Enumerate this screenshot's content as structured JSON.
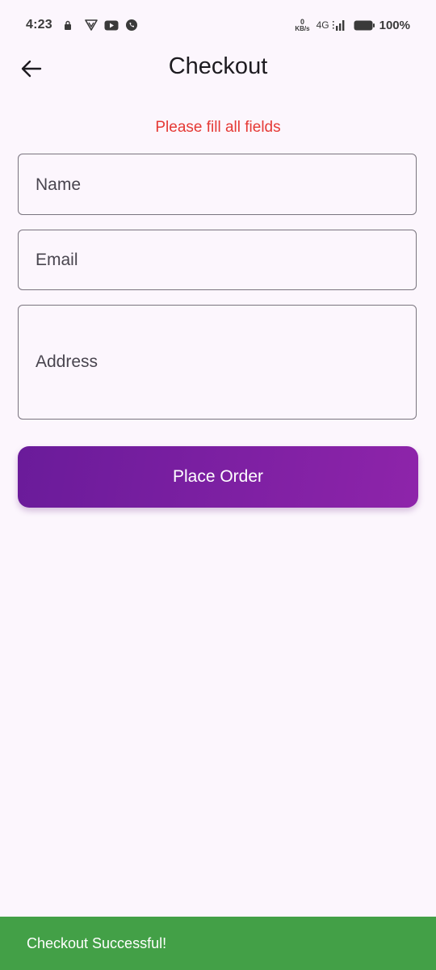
{
  "status_bar": {
    "time": "4:23",
    "net_speed_value": "0",
    "net_speed_unit": "KB/s",
    "network_type": "4G",
    "battery_percent": "100%",
    "icons_left": [
      "sim-lock-icon",
      "vpn-shield-icon",
      "youtube-icon",
      "whatsapp-icon"
    ],
    "icons_right": [
      "signal-icon",
      "battery-icon"
    ]
  },
  "app_bar": {
    "title": "Checkout",
    "back_icon": "arrow-left-icon"
  },
  "form": {
    "error_message": "Please fill all fields",
    "name_label": "Name",
    "email_label": "Email",
    "address_label": "Address",
    "submit_label": "Place Order"
  },
  "snackbar": {
    "message": "Checkout Successful!"
  },
  "colors": {
    "background": "#FCF6FD",
    "error": "#E53935",
    "button_gradient_start": "#6A1B9A",
    "button_gradient_end": "#8E24AA",
    "snackbar": "#43A047",
    "field_border": "#79747E"
  }
}
